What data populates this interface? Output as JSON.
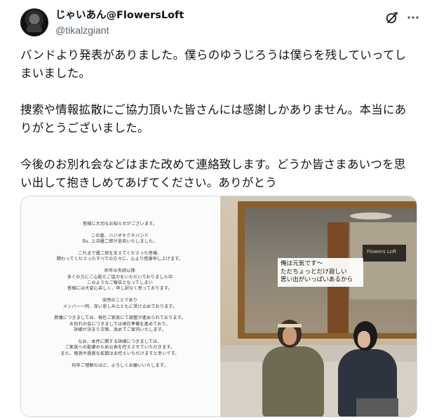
{
  "post": {
    "author": {
      "display_name": "じゃいあん@FlowersLoft",
      "handle": "@tikalzgiant"
    },
    "icons": {
      "grok": "grok-icon",
      "more": "more-icon"
    },
    "text_lines": [
      "バンドより発表がありました。僕らのゆうじろうは僕らを残していってし",
      "まいました。",
      "",
      "捜索や情報拡散にご協力頂いた皆さんには感謝しかありません。本当にあ",
      "りがとうございました。",
      "",
      "今後のお別れ会などはまた改めて連絡致します。どうか皆さまあいつを思",
      "い出して抱きしめてあげてください。ありがとう"
    ],
    "media": {
      "notice_lines": [
        "皆様に大切なお知らせがございます。",
        "",
        "この度、ハジオキクチバンド",
        "Ba. 上沼優二郎が逝去いたしました。",
        "",
        "これまで優二郎を支えてくださった皆様、",
        "関わってくださったすべての方々に、心より感謝申し上げます。",
        "",
        "昨年の失踪以降",
        "多くの方にご心配とご協力をいただいておりました中",
        "このようなご報告となってしまい",
        "皆様には大変心苦しく、申し訳なく思っております。",
        "",
        "突然のことであり",
        "メンバー一同、深い悲しみとともに受け止めております。",
        "",
        "葬儀につきましては、現在ご家族にて調整が進められております。",
        "お別れの会につきましては現在準備を進めており、",
        "詳細が決まり次第、改めてご案内いたします。",
        "",
        "なお、本件に関する詳細につきましては、",
        "ご家族への配慮のため公表を控えさせていただきます。",
        "また、憶測や過度な拡散はお控えいただけますと幸いです。",
        "",
        "何卒ご理解のほど、よろしくお願いいたします。"
      ],
      "photo_caption": [
        "俺は元気です〜",
        "ただちょっとだけ寂しい",
        "思い出がいっぱいあるから"
      ],
      "mirror_sign": "Flowers Loft"
    }
  }
}
